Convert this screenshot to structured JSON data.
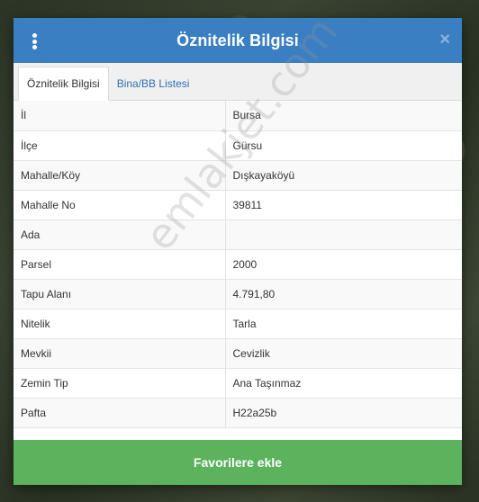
{
  "header": {
    "title": "Öznitelik Bilgisi",
    "close_symbol": "×",
    "menu_icon": "vertical-ellipsis-icon"
  },
  "tabs": [
    {
      "label": "Öznitelik Bilgisi",
      "active": true
    },
    {
      "label": "Bina/BB Listesi",
      "active": false
    }
  ],
  "rows": [
    {
      "key": "İl",
      "value": "Bursa"
    },
    {
      "key": "İlçe",
      "value": "Gürsu"
    },
    {
      "key": "Mahalle/Köy",
      "value": "Dışkayaköyü"
    },
    {
      "key": "Mahalle No",
      "value": "39811"
    },
    {
      "key": "Ada",
      "value": ""
    },
    {
      "key": "Parsel",
      "value": "2000"
    },
    {
      "key": "Tapu Alanı",
      "value": "4.791,80"
    },
    {
      "key": "Nitelik",
      "value": "Tarla"
    },
    {
      "key": "Mevkii",
      "value": "Cevizlik"
    },
    {
      "key": "Zemin Tip",
      "value": "Ana Taşınmaz"
    },
    {
      "key": "Pafta",
      "value": "H22a25b"
    }
  ],
  "footer": {
    "button_label": "Favorilere ekle"
  },
  "watermark": "emlakjet.com",
  "colors": {
    "header": "#3a7fc2",
    "footer_button": "#5cb25d",
    "tab_link": "#2d6fb5"
  }
}
